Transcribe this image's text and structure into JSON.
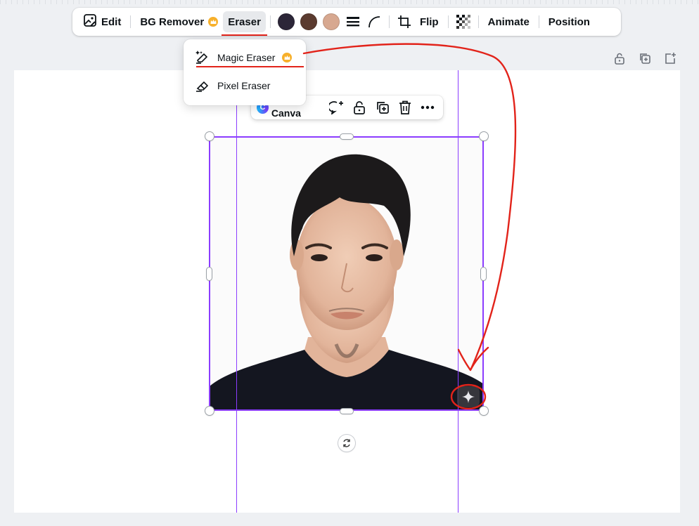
{
  "toolbar": {
    "edit_label": "Edit",
    "bg_remover_label": "BG Remover",
    "eraser_label": "Eraser",
    "flip_label": "Flip",
    "animate_label": "Animate",
    "position_label": "Position",
    "colors": [
      "#2c2638",
      "#5b3b2f",
      "#d7a890"
    ],
    "icons": [
      "image-edit-icon",
      "crown-icon",
      "border-style-icon",
      "corner-rounding-icon",
      "crop-icon",
      "transparency-icon"
    ]
  },
  "eraser_menu": {
    "items": [
      {
        "label": "Magic Eraser",
        "icon": "magic-eraser-icon",
        "premium": true
      },
      {
        "label": "Pixel Eraser",
        "icon": "eraser-icon",
        "premium": false
      }
    ]
  },
  "context_toolbar": {
    "ask_label": "Ask Canva",
    "icons": [
      "comment-add-icon",
      "lock-icon",
      "duplicate-icon",
      "trash-icon",
      "more-icon"
    ]
  },
  "page_actions": {
    "icons": [
      "lock-icon",
      "duplicate-page-icon",
      "add-page-icon"
    ]
  },
  "colors": {
    "selection": "#8b3dff",
    "annotation": "#e2231a",
    "premium": "#f7b02b"
  }
}
